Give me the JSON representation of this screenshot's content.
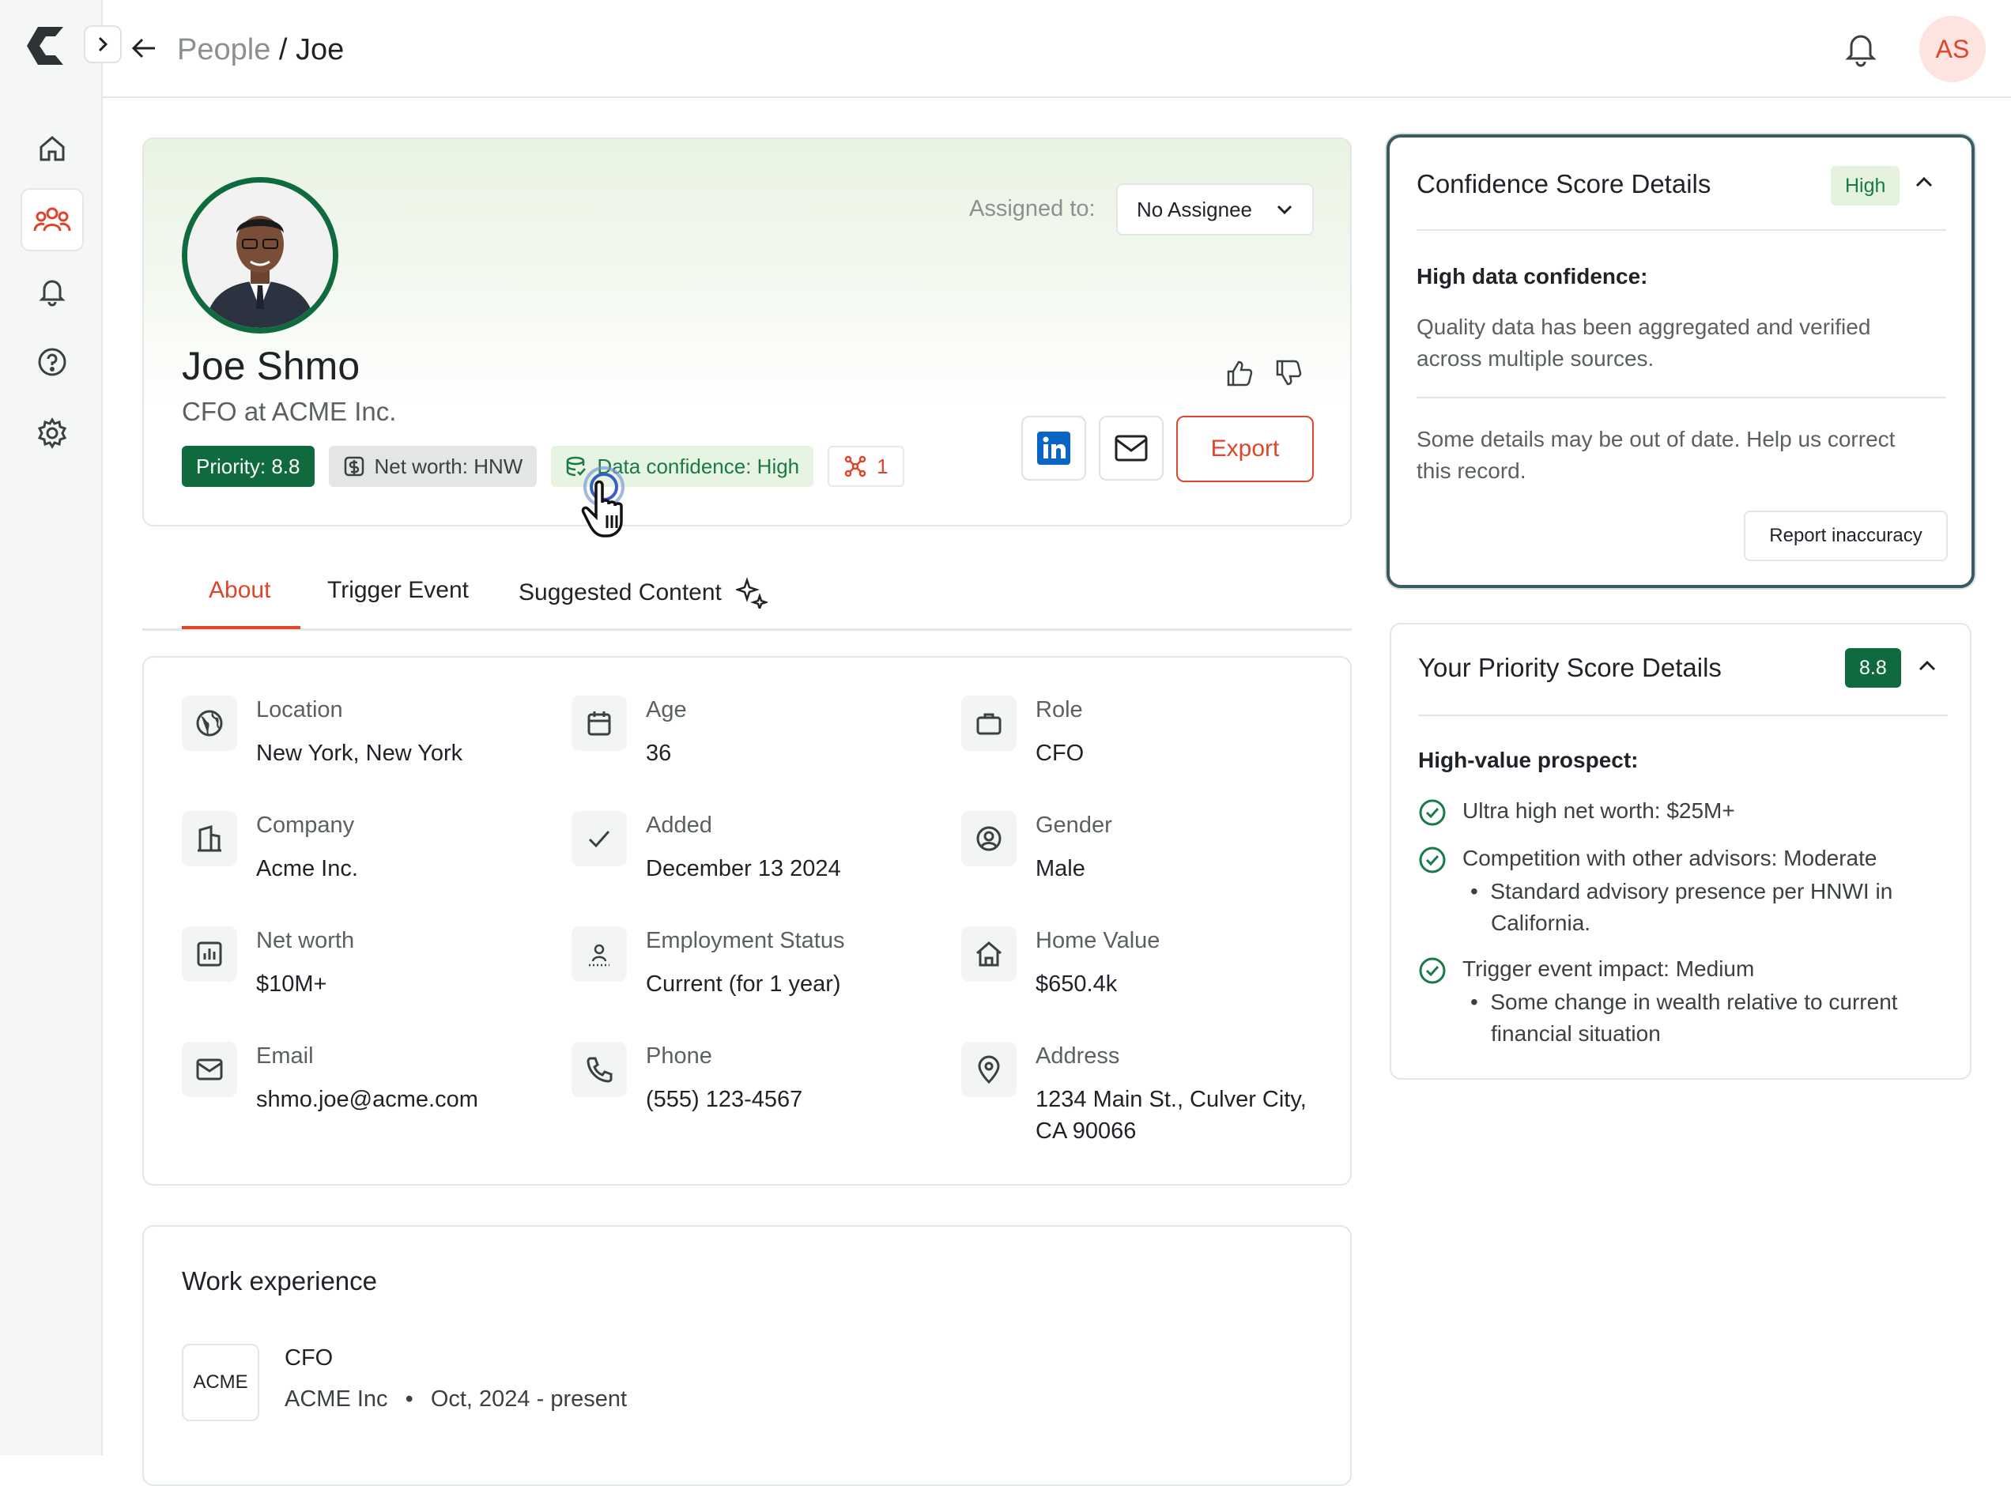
{
  "breadcrumb": {
    "parent": "People",
    "separator": "/",
    "current": "Joe"
  },
  "user_initials": "AS",
  "profile": {
    "name": "Joe Shmo",
    "role": "CFO at ACME Inc.",
    "assigned_label": "Assigned to:",
    "assignee": "No Assignee",
    "badges": {
      "priority": "Priority: 8.8",
      "net_worth": "Net worth: HNW",
      "confidence": "Data confidence: High",
      "links": "1"
    },
    "export_label": "Export"
  },
  "tabs": [
    {
      "label": "About",
      "active": true
    },
    {
      "label": "Trigger Event"
    },
    {
      "label": "Suggested Content"
    }
  ],
  "about": {
    "fields": [
      {
        "label": "Location",
        "value": "New York, New York",
        "icon": "globe-icon"
      },
      {
        "label": "Age",
        "value": "36",
        "icon": "calendar-icon"
      },
      {
        "label": "Role",
        "value": "CFO",
        "icon": "briefcase-icon"
      },
      {
        "label": "Company",
        "value": "Acme Inc.",
        "icon": "building-icon"
      },
      {
        "label": "Added",
        "value": "December 13 2024",
        "icon": "check-icon"
      },
      {
        "label": "Gender",
        "value": "Male",
        "icon": "user-circle-icon"
      },
      {
        "label": "Net worth",
        "value": "$10M+",
        "icon": "chart-icon"
      },
      {
        "label": "Employment Status",
        "value": "Current (for 1 year)",
        "icon": "person-icon"
      },
      {
        "label": "Home Value",
        "value": "$650.4k",
        "icon": "home-icon"
      },
      {
        "label": "Email",
        "value": "shmo.joe@acme.com",
        "icon": "mail-icon"
      },
      {
        "label": "Phone",
        "value": "(555) 123-4567",
        "icon": "phone-icon"
      },
      {
        "label": "Address",
        "value_line1": "1234 Main St., Culver City,",
        "value_line2": "CA 90066",
        "icon": "pin-icon"
      }
    ]
  },
  "work": {
    "title": "Work experience",
    "logo_text": "ACME",
    "job_title": "CFO",
    "company": "ACME Inc",
    "dot": "•",
    "period": "Oct, 2024 - present"
  },
  "confidence_panel": {
    "title": "Confidence Score Details",
    "pill": "High",
    "heading": "High data confidence:",
    "text1_line1": "Quality data has been aggregated and verified",
    "text1_line2": "across multiple sources.",
    "text2_line1": "Some details may be out of date. Help us correct",
    "text2_line2": "this record.",
    "report_label": "Report inaccuracy"
  },
  "priority_panel": {
    "title": "Your Priority Score Details",
    "pill": "8.8",
    "heading": "High-value prospect:",
    "item1": "Ultra high net worth: $25M+",
    "item2": "Competition with other advisors: Moderate",
    "item2_sub_line1": "Standard advisory presence per HNWI in",
    "item2_sub_line2": "California.",
    "item3": "Trigger event impact: Medium",
    "item3_sub_line1": "Some change in wealth relative to current",
    "item3_sub_line2": "financial situation",
    "bullet": "•"
  },
  "colors": {
    "accent": "#e0452a",
    "brand_green": "#0f6b3e",
    "panel_border": "#3b5a63"
  }
}
